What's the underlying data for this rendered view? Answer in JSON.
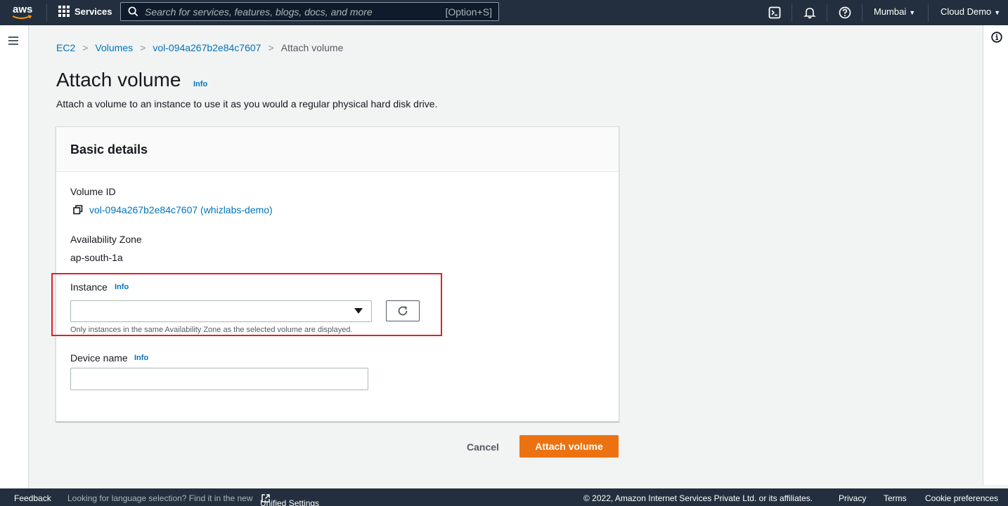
{
  "topnav": {
    "logo_text": "aws",
    "services_label": "Services",
    "search_placeholder": "Search for services, features, blogs, docs, and more",
    "search_shortcut": "[Option+S]",
    "icons": [
      "cloudshell-icon",
      "bell-icon",
      "help-icon"
    ],
    "region": "Mumbai",
    "account": "Cloud Demo"
  },
  "breadcrumb": {
    "items": [
      {
        "label": "EC2",
        "link": true
      },
      {
        "label": "Volumes",
        "link": true
      },
      {
        "label": "vol-094a267b2e84c7607",
        "link": true
      },
      {
        "label": "Attach volume",
        "link": false
      }
    ]
  },
  "page": {
    "title": "Attach volume",
    "info_label": "Info",
    "description": "Attach a volume to an instance to use it as you would a regular physical hard disk drive."
  },
  "panel": {
    "title": "Basic details",
    "volume_id_label": "Volume ID",
    "volume_id_value": "vol-094a267b2e84c7607 (whizlabs-demo)",
    "az_label": "Availability Zone",
    "az_value": "ap-south-1a",
    "instance_label": "Instance",
    "instance_info": "Info",
    "instance_selected": "",
    "instance_hint": "Only instances in the same Availability Zone as the selected volume are displayed.",
    "device_label": "Device name",
    "device_info": "Info",
    "device_value": ""
  },
  "actions": {
    "cancel": "Cancel",
    "submit": "Attach volume"
  },
  "footer": {
    "feedback": "Feedback",
    "language_prompt": "Looking for language selection? Find it in the new",
    "unified_settings": "Unified Settings",
    "copyright": "© 2022, Amazon Internet Services Private Ltd. or its affiliates.",
    "privacy": "Privacy",
    "terms": "Terms",
    "cookies": "Cookie preferences"
  },
  "colors": {
    "nav_bg": "#232f3e",
    "link": "#0073bb",
    "primary": "#ec7211",
    "highlight": "#e0202a"
  }
}
